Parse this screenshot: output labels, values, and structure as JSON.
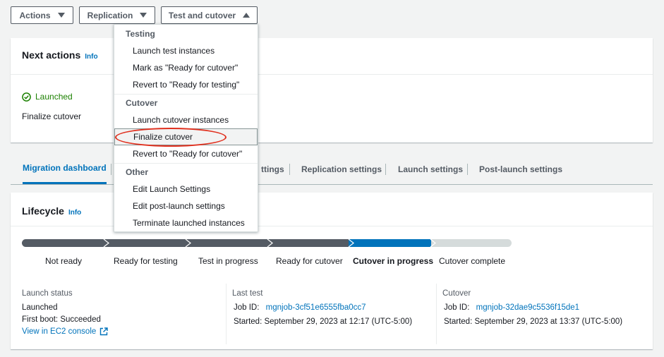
{
  "toolbar": {
    "actions_label": "Actions",
    "replication_label": "Replication",
    "test_cutover_label": "Test and cutover"
  },
  "dropdown": {
    "groups": {
      "testing": "Testing",
      "cutover": "Cutover",
      "other": "Other"
    },
    "items": {
      "launch_test": "Launch test instances",
      "mark_ready_cutover": "Mark as \"Ready for cutover\"",
      "revert_ready_testing": "Revert to \"Ready for testing\"",
      "launch_cutover": "Launch cutover instances",
      "finalize_cutover": "Finalize cutover",
      "revert_ready_cutover": "Revert to \"Ready for cutover\"",
      "edit_launch": "Edit Launch Settings",
      "edit_post_launch": "Edit post-launch settings",
      "terminate": "Terminate launched instances"
    }
  },
  "next_actions": {
    "title": "Next actions",
    "info": "Info",
    "status": "Launched",
    "action": "Finalize cutover"
  },
  "tabs": {
    "migration_dashboard": "Migration dashboard",
    "partial_settings": "ttings",
    "replication_settings": "Replication settings",
    "launch_settings": "Launch settings",
    "post_launch_settings": "Post-launch settings"
  },
  "lifecycle": {
    "title": "Lifecycle",
    "info": "Info",
    "steps": [
      "Not ready",
      "Ready for testing",
      "Test in progress",
      "Ready for cutover",
      "Cutover in progress",
      "Cutover complete"
    ],
    "current_step": "Cutover in progress",
    "launch_status": {
      "title": "Launch status",
      "status": "Launched",
      "first_boot": "First boot: Succeeded",
      "ec2_link": "View in EC2 console"
    },
    "last_test": {
      "title": "Last test",
      "job_label": "Job ID:",
      "job_id": "mgnjob-3cf51e6555fba0cc7",
      "started": "Started: September 29, 2023 at 12:17 (UTC-5:00)"
    },
    "cutover": {
      "title": "Cutover",
      "job_label": "Job ID:",
      "job_id": "mgnjob-32dae9c5536f15de1",
      "started": "Started: September 29, 2023 at 13:37 (UTC-5:00)"
    }
  },
  "colors": {
    "accent_blue": "#0073bb",
    "progress_done": "#545b64",
    "progress_current": "#0073bb",
    "progress_pending": "#d5dbdb",
    "success_green": "#1d8102",
    "annotation_red": "#e0301e"
  },
  "icons": {
    "success": "check-circle-icon",
    "external": "external-link-icon",
    "caret_down": "caret-down-icon",
    "caret_up": "caret-up-icon"
  }
}
